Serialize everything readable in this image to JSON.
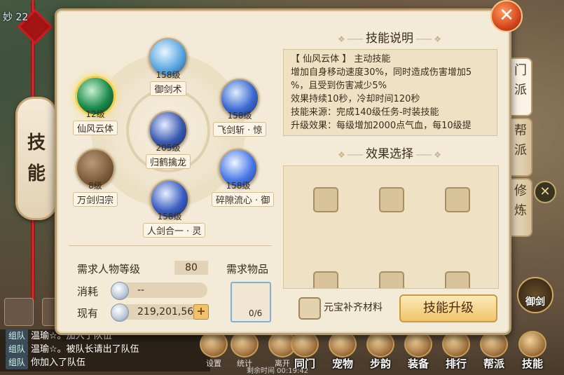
{
  "background": {
    "player_tag": "妙 22"
  },
  "left_tab": {
    "chars": [
      "技",
      "能"
    ]
  },
  "panel": {
    "skills": [
      {
        "level": "158级",
        "name": "御剑术",
        "color": "#5aa8e0"
      },
      {
        "level": "158级",
        "name": "飞剑斩 · 惊",
        "color": "#3a6ad0"
      },
      {
        "level": "158级",
        "name": "碎隙流心 · 御",
        "color": "#4a7ae8"
      },
      {
        "level": "158级",
        "name": "人剑合一 · 灵",
        "color": "#3a5ec0"
      },
      {
        "level": "8级",
        "name": "万剑归宗",
        "color": "#7a5a3a"
      },
      {
        "level": "12级",
        "name": "仙风云体",
        "color": "#1a8a4a"
      },
      {
        "level": "205级",
        "name": "归鹤擒龙",
        "color": "#3a5ab0"
      }
    ],
    "requirements": {
      "level_label": "需求人物等级",
      "level_value": "80",
      "cost_label": "消耗",
      "cost_value": "--",
      "have_label": "现有",
      "have_value": "219,201,564",
      "item_label": "需求物品",
      "item_count": "0/6"
    },
    "description": {
      "title": "技能说明",
      "lines": [
        "【 仙风云体 】   主动技能",
        "增加自身移动速度30%，同时造成伤害增加5",
        "%，且受到伤害减少5%",
        "效果持续10秒，冷却时间120秒",
        "技能来源：完成140级任务-时装技能",
        "升级效果：每级增加2000点气血，每10级提"
      ]
    },
    "effect": {
      "title": "效果选择"
    },
    "yuanbao_label": "元宝补齐材料",
    "upgrade_label": "技能升级",
    "close_label": "✕"
  },
  "right_tabs": [
    {
      "label": "门派",
      "active": true
    },
    {
      "label": "帮派",
      "active": false
    },
    {
      "label": "修炼",
      "active": false
    }
  ],
  "side_close": "✕",
  "sword_btn": "御剑",
  "chat": [
    {
      "tag": "组队",
      "text": "温瑜☆。加入了队伍"
    },
    {
      "tag": "组队",
      "text": "温瑜☆。被队长请出了队伍"
    },
    {
      "tag": "组队",
      "text": "你加入了队伍"
    }
  ],
  "bottom_bar": [
    {
      "label": "统计",
      "small": true
    },
    {
      "label": "离开",
      "small": true
    },
    {
      "label": "同门"
    },
    {
      "label": "宠物"
    },
    {
      "label": "步韵"
    },
    {
      "label": "装备"
    },
    {
      "label": "排行"
    },
    {
      "label": "帮派"
    },
    {
      "label": "技能"
    }
  ],
  "bottom_extra": {
    "left": "设置",
    "timer": "剩余时间 00:19:42"
  }
}
